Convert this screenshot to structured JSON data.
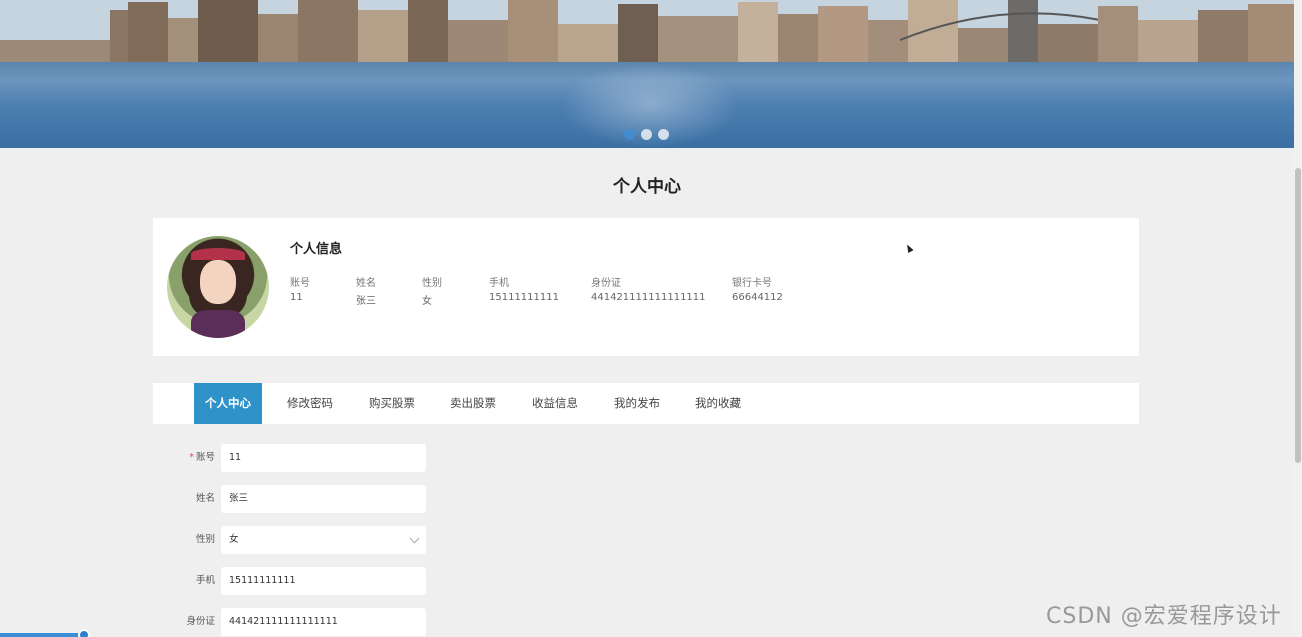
{
  "banner": {
    "slides": 3,
    "active_slide": 1
  },
  "page_title": "个人中心",
  "profile": {
    "heading": "个人信息",
    "fields": [
      {
        "label": "账号",
        "value": "11"
      },
      {
        "label": "姓名",
        "value": "张三"
      },
      {
        "label": "性别",
        "value": "女"
      },
      {
        "label": "手机",
        "value": "15111111111"
      },
      {
        "label": "身份证",
        "value": "441421111111111111"
      },
      {
        "label": "银行卡号",
        "value": "66644112"
      }
    ]
  },
  "tabs": [
    "个人中心",
    "修改密码",
    "购买股票",
    "卖出股票",
    "收益信息",
    "我的发布",
    "我的收藏"
  ],
  "active_tab": "个人中心",
  "form": {
    "account": {
      "label": "账号",
      "value": "11",
      "required": true
    },
    "name": {
      "label": "姓名",
      "value": "张三"
    },
    "gender": {
      "label": "性别",
      "value": "女"
    },
    "phone": {
      "label": "手机",
      "value": "15111111111"
    },
    "id_card": {
      "label": "身份证",
      "value": "441421111111111111"
    }
  },
  "watermark": "CSDN @宏爱程序设计",
  "colors": {
    "accent": "#2f93c9",
    "background": "#efeff0"
  }
}
